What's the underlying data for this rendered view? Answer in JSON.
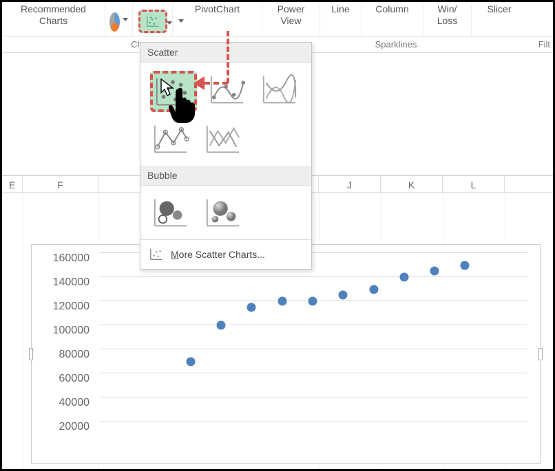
{
  "ribbon": {
    "recommended": "Recommended\nCharts",
    "pivotchart": "PivotChart",
    "powerview": "Power\nView",
    "line": "Line",
    "column": "Column",
    "winloss": "Win/\nLoss",
    "slicer": "Slicer"
  },
  "group_labels": {
    "charts": "Cha",
    "sparklines": "Sparklines",
    "filter": "Filt"
  },
  "dropdown": {
    "scatter_label": "Scatter",
    "bubble_label": "Bubble",
    "more_label_pre": "M",
    "more_label": "ore Scatter Charts..."
  },
  "columns": {
    "e": "E",
    "f": "F",
    "j": "J",
    "k": "K",
    "l": "L"
  },
  "chart_data": {
    "type": "scatter",
    "title": "",
    "xlabel": "",
    "ylabel": "",
    "ylim": [
      0,
      160000
    ],
    "y_ticks": [
      20000,
      40000,
      60000,
      80000,
      100000,
      120000,
      140000,
      160000
    ],
    "x": [
      3,
      4,
      5,
      6,
      7,
      8,
      9,
      10,
      11,
      12
    ],
    "values": [
      70000,
      100000,
      115000,
      120000,
      120000,
      125000,
      130000,
      140000,
      145000,
      150000
    ]
  }
}
